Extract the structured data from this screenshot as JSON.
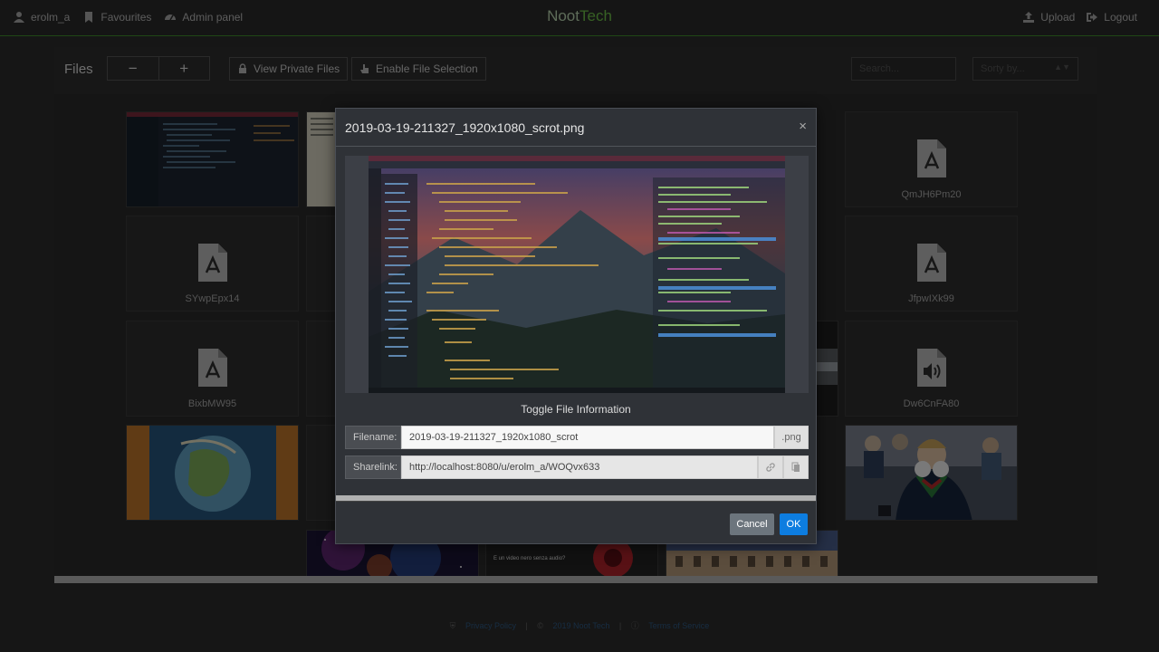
{
  "nav": {
    "user": "erolm_a",
    "favourites": "Favourites",
    "admin": "Admin panel",
    "brand_part1": "Noot",
    "brand_part2": "Tech",
    "upload": "Upload",
    "logout": "Logout"
  },
  "toolbar": {
    "title": "Files",
    "zoom_out": "−",
    "zoom_in": "+",
    "private_files": "View Private Files",
    "enable_selection": "Enable File Selection",
    "search_placeholder": "Search...",
    "sort_placeholder": "Sorty by..."
  },
  "tiles": {
    "pdf1": "QmJH6Pm20",
    "pdf2": "SYwpEpx14",
    "pdf3": "JfpwIXk99",
    "pdf4": "BixbMW95",
    "audio1": "Dw6CnFA80",
    "thumb_caption": "E un video nero senza audio?"
  },
  "footer": {
    "privacy": "Privacy Policy",
    "copyright": "2019 Noot Tech",
    "terms": "Terms of Service"
  },
  "modal": {
    "title": "2019-03-19-211327_1920x1080_scrot.png",
    "toggle_info": "Toggle File Information",
    "filename_label": "Filename:",
    "filename_value": "2019-03-19-211327_1920x1080_scrot",
    "extension": ".png",
    "sharelink_label": "Sharelink:",
    "sharelink_value": "http://localhost:8080/u/erolm_a/WOQvx633",
    "cancel": "Cancel",
    "ok": "OK"
  },
  "colors": {
    "accent_green": "#6ec248",
    "primary_blue": "#0d7de0",
    "secondary_gray": "#6c757d"
  }
}
